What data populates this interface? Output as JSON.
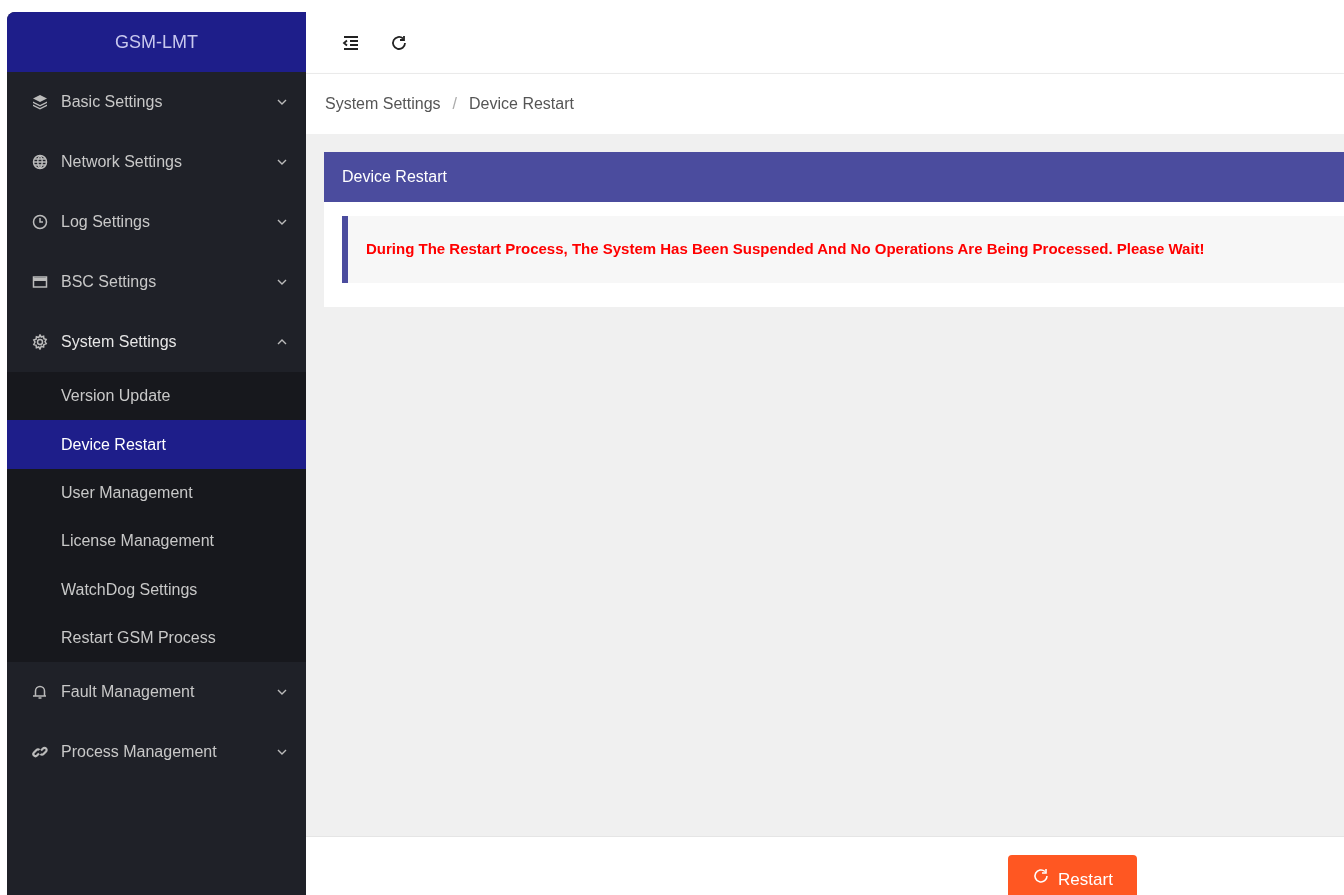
{
  "sidebar": {
    "logo": "GSM-LMT",
    "items": [
      {
        "label": "Basic Settings",
        "expanded": false
      },
      {
        "label": "Network Settings",
        "expanded": false
      },
      {
        "label": "Log Settings",
        "expanded": false
      },
      {
        "label": "BSC Settings",
        "expanded": false
      },
      {
        "label": "System Settings",
        "expanded": true,
        "children": [
          {
            "label": "Version Update",
            "selected": false
          },
          {
            "label": "Device Restart",
            "selected": true
          },
          {
            "label": "User Management",
            "selected": false
          },
          {
            "label": "License Management",
            "selected": false
          },
          {
            "label": "WatchDog Settings",
            "selected": false
          },
          {
            "label": "Restart GSM Process",
            "selected": false
          }
        ]
      },
      {
        "label": "Fault Management",
        "expanded": false
      },
      {
        "label": "Process Management",
        "expanded": false
      }
    ]
  },
  "breadcrumb": [
    "System Settings",
    "Device Restart"
  ],
  "breadcrumb_separator": "/",
  "card": {
    "title": "Device Restart",
    "alert": "During The Restart Process, The System Has Been Suspended And No Operations Are Being Processed. Please Wait!"
  },
  "footer": {
    "button": "Restart"
  }
}
